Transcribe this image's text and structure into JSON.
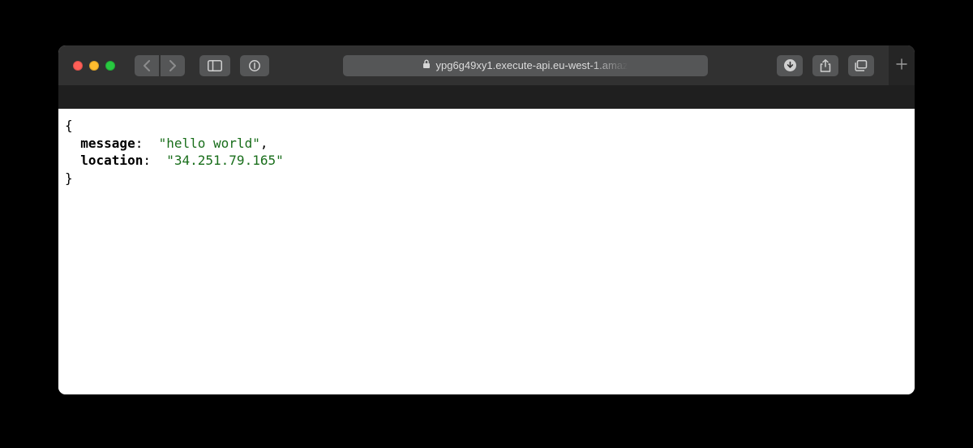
{
  "window": {
    "address_display": "ypg6g49xy1.execute-api.eu-west-1.amaz"
  },
  "response": {
    "brace_open": "{",
    "brace_close": "}",
    "entries": [
      {
        "key": "message",
        "colon": ": ",
        "pad": " ",
        "value_quoted": "\"hello world\"",
        "trail": ","
      },
      {
        "key": "location",
        "colon": ": ",
        "pad": " ",
        "value_quoted": "\"34.251.79.165\"",
        "trail": ""
      }
    ]
  }
}
